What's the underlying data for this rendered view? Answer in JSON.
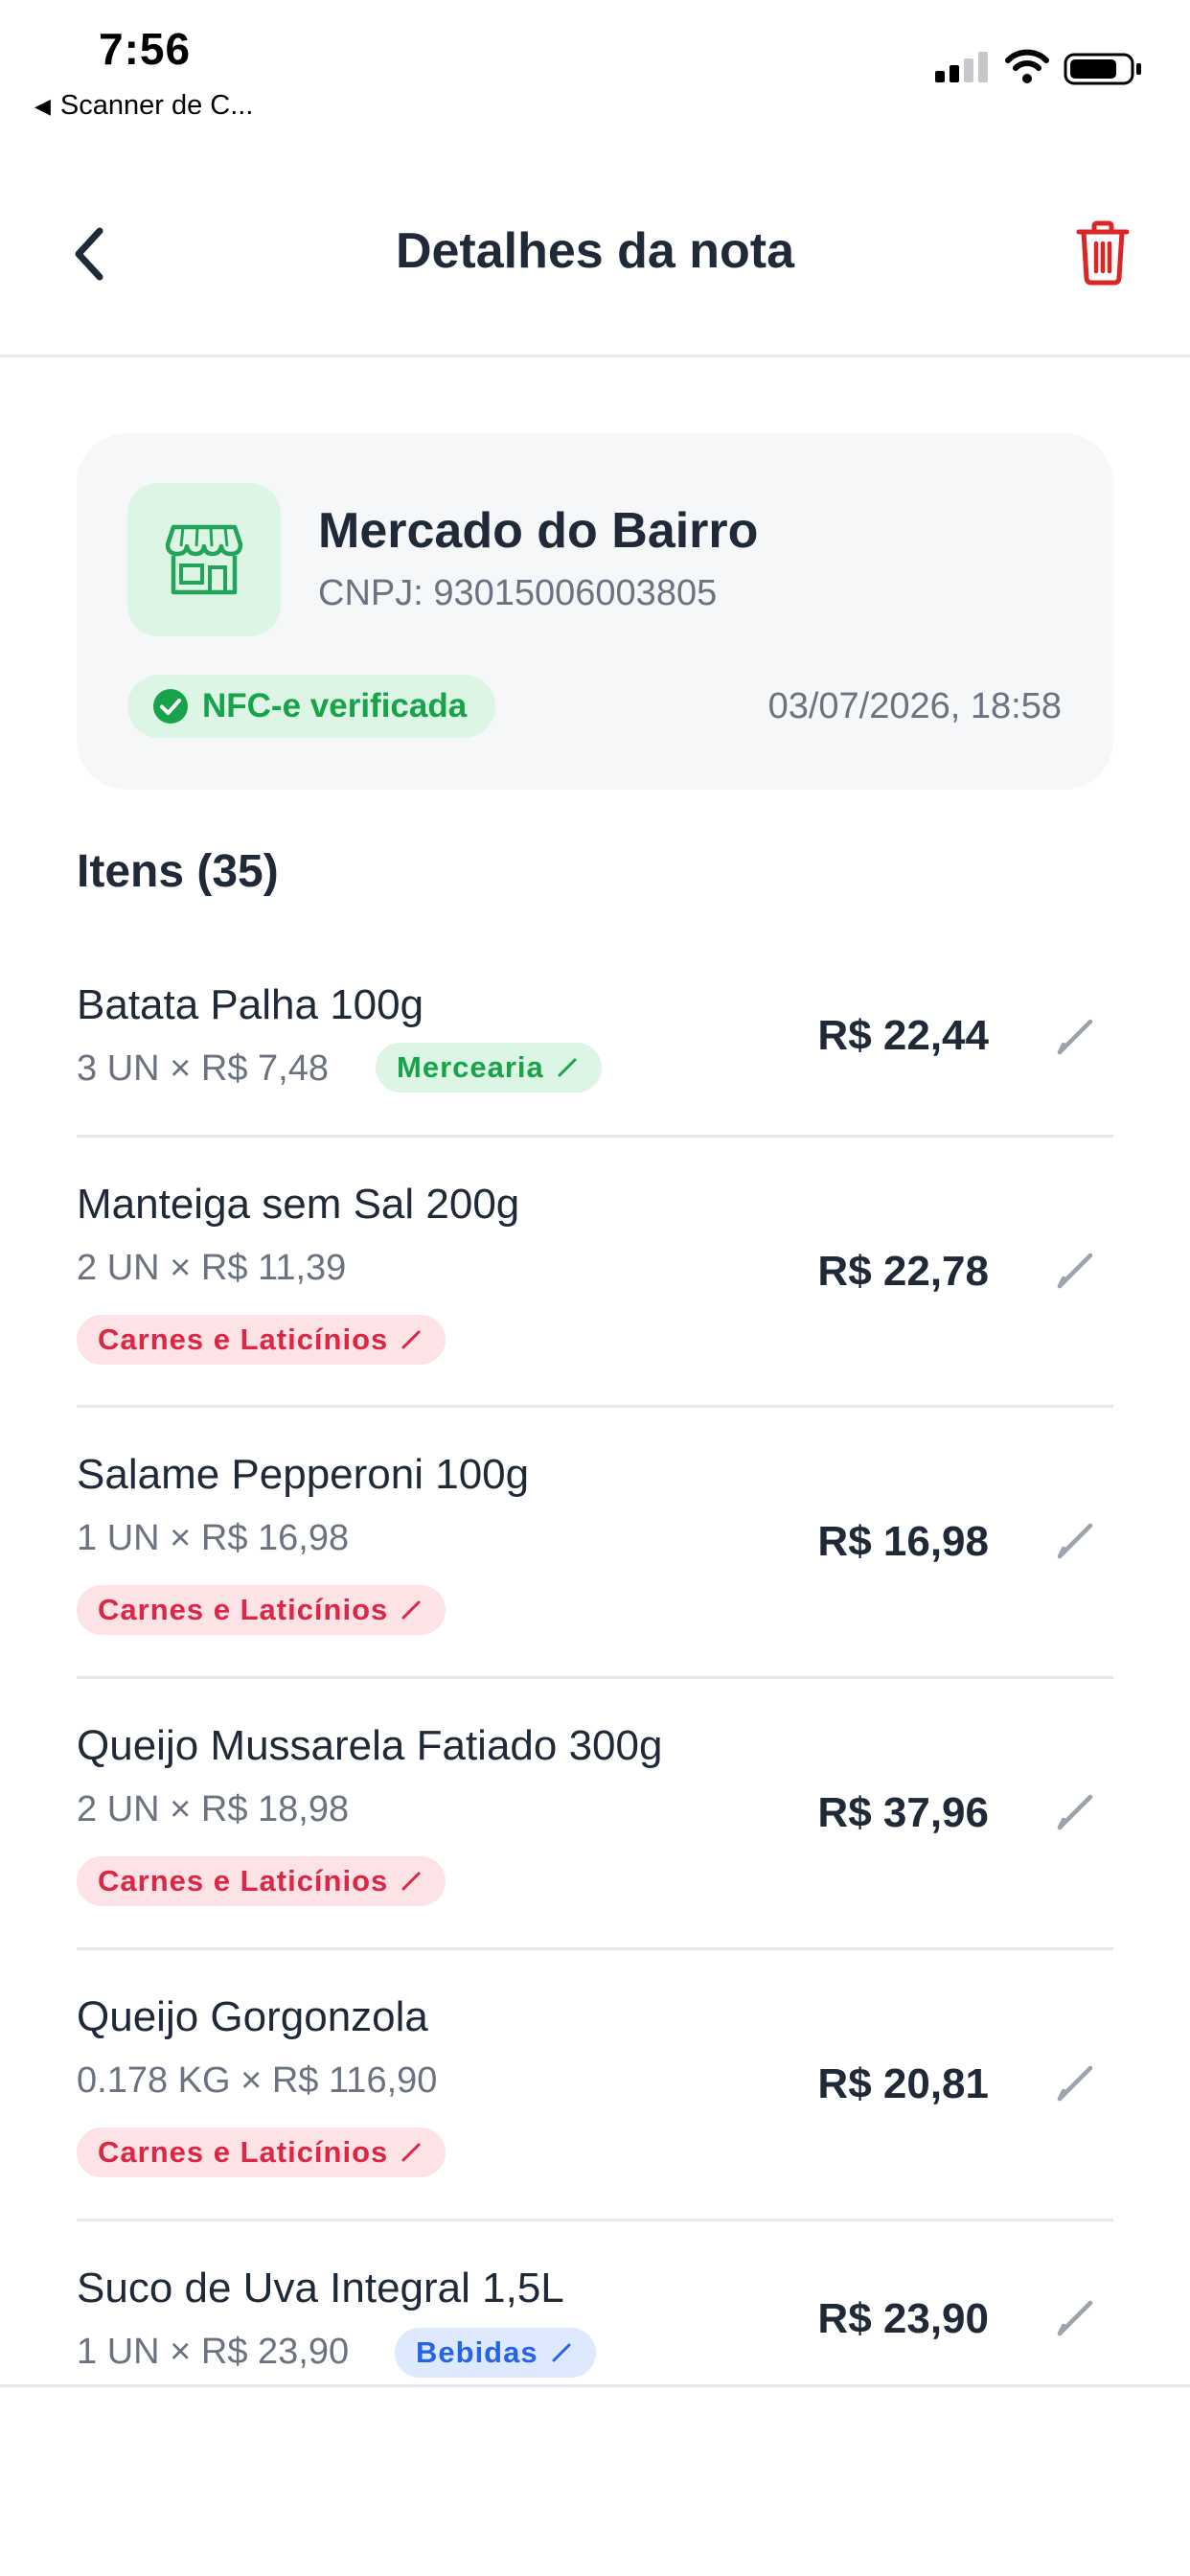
{
  "status_bar": {
    "time": "7:56",
    "back_app": "Scanner de C..."
  },
  "header": {
    "title": "Detalhes da nota"
  },
  "store": {
    "name": "Mercado do Bairro",
    "cnpj": "CNPJ: 93015006003805",
    "verified_label": "NFC-e verificada",
    "date": "03/07/2026, 18:58"
  },
  "items_title": "Itens (35)",
  "items": [
    {
      "name": "Batata Palha 100g",
      "qty": "3 UN × R$ 7,48",
      "price": "R$ 22,44",
      "category": "Mercearia",
      "category_color": "#16a34a"
    },
    {
      "name": "Manteiga sem Sal 200g",
      "qty": "2 UN × R$ 11,39",
      "price": "R$ 22,78",
      "category": "Carnes e Laticínios",
      "category_color": "#dc2645"
    },
    {
      "name": "Salame Pepperoni 100g",
      "qty": "1 UN × R$ 16,98",
      "price": "R$ 16,98",
      "category": "Carnes e Laticínios",
      "category_color": "#dc2645"
    },
    {
      "name": "Queijo Mussarela Fatiado 300g",
      "qty": "2 UN × R$ 18,98",
      "price": "R$ 37,96",
      "category": "Carnes e Laticínios",
      "category_color": "#dc2645"
    },
    {
      "name": "Queijo Gorgonzola",
      "qty": "0.178 KG × R$ 116,90",
      "price": "R$ 20,81",
      "category": "Carnes e Laticínios",
      "category_color": "#dc2645"
    },
    {
      "name": "Suco de Uva Integral 1,5L",
      "qty": "1 UN × R$ 23,90",
      "price": "R$ 23,90",
      "category": "Bebidas",
      "category_color": "#2563eb"
    }
  ],
  "colors": {
    "accent_green": "#16a34a",
    "danger_red": "#dc2626",
    "text_primary": "#1f2937",
    "text_secondary": "#6b7280"
  },
  "icons": [
    "back-chevron-icon",
    "trash-icon",
    "store-icon",
    "check-circle-icon",
    "pencil-icon"
  ]
}
